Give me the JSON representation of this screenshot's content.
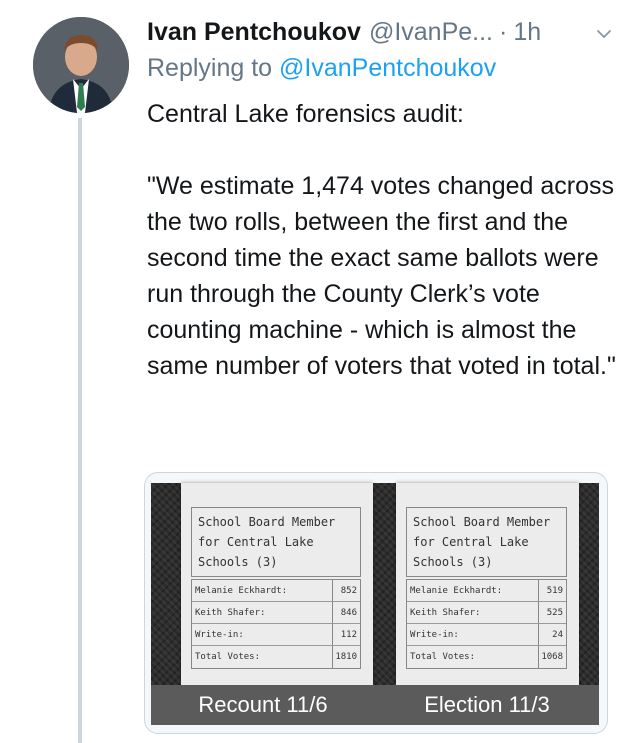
{
  "tweet": {
    "author_name": "Ivan Pentchoukov",
    "author_handle": "@IvanPe...",
    "separator": "·",
    "time": "1h",
    "reply_prefix": "Replying to",
    "reply_to": "@IvanPentchoukov",
    "text": "Central Lake forensics audit:\n\n\"We estimate 1,474 votes changed across the two rolls, between the first and the second time the exact same ballots were run through the County Clerk’s vote counting machine - which is almost the same number of voters that voted in total.\""
  },
  "media": {
    "receipts": [
      {
        "title": "School Board Member\nfor Central Lake\nSchools (3)",
        "rows": [
          {
            "label": "Melanie Eckhardt:",
            "value": "852"
          },
          {
            "label": "Keith Shafer:",
            "value": "846"
          },
          {
            "label": "Write-in:",
            "value": "112"
          },
          {
            "label": "Total Votes:",
            "value": "1810"
          }
        ]
      },
      {
        "title": "School Board Member\nfor Central Lake\nSchools (3)",
        "rows": [
          {
            "label": "Melanie Eckhardt:",
            "value": "519"
          },
          {
            "label": "Keith Shafer:",
            "value": "525"
          },
          {
            "label": "Write-in:",
            "value": "24"
          },
          {
            "label": "Total Votes:",
            "value": "1068"
          }
        ]
      }
    ],
    "captions": [
      "Recount 11/6",
      "Election 11/3"
    ]
  },
  "colors": {
    "link": "#1da1f2",
    "muted": "#657786",
    "thread_line": "#ccd6dd"
  },
  "icons": {
    "caret": "chevron-down-icon",
    "avatar": "profile-photo"
  }
}
